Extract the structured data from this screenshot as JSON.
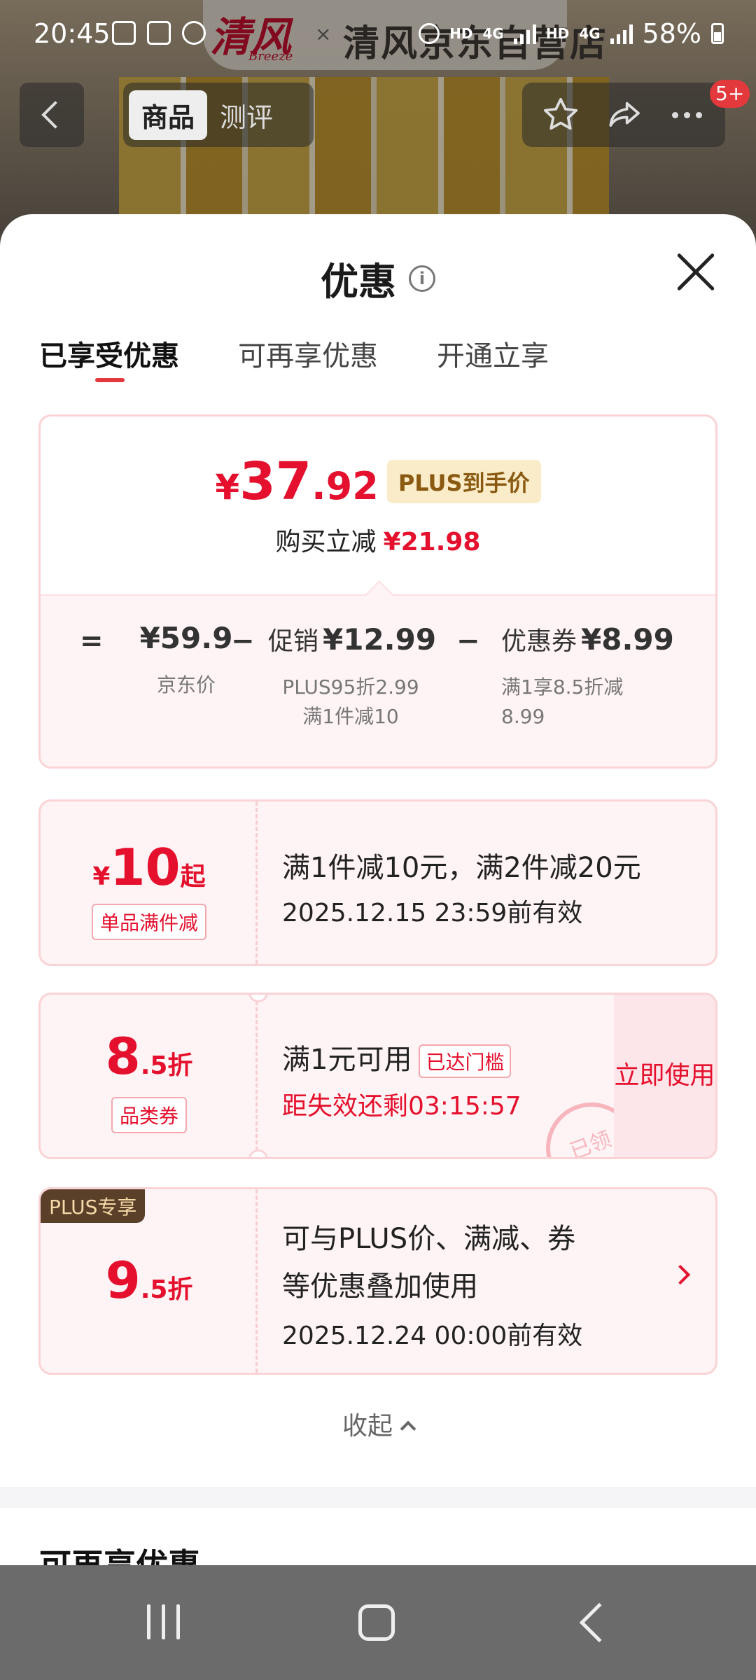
{
  "status_bar": {
    "time": "20:45",
    "battery": "58%",
    "net1": "HD",
    "net2": "4G",
    "net3": "HD",
    "net4": "4G"
  },
  "background": {
    "brand": "清风",
    "brand_sub": "Breeze",
    "store": "清风京东自营店"
  },
  "top_nav": {
    "tabs": [
      "商品",
      "测评"
    ],
    "badge": "5+"
  },
  "sheet": {
    "title": "优惠",
    "tabs": [
      "已享受优惠",
      "可再享优惠",
      "开通立享"
    ]
  },
  "price_summary": {
    "yen": "¥",
    "price_int": "37",
    "price_dec": ".92",
    "tag": "PLUS到手价",
    "sub_label": "购买立减",
    "sub_value": "¥21.98",
    "eq": "=",
    "minus": "−",
    "jd_price": "¥59.9",
    "jd_label": "京东价",
    "promo_label": "促销",
    "promo_value": "¥12.99",
    "promo_desc1": "PLUS95折2.99",
    "promo_desc2": "满1件减10",
    "coupon_label": "优惠券",
    "coupon_value": "¥8.99",
    "coupon_desc1": "满1享8.5折减",
    "coupon_desc2": "8.99"
  },
  "coupons": [
    {
      "yen": "¥",
      "big": "10",
      "suffix": "起",
      "tag": "单品满件减",
      "line1": "满1件减10元，满2件减20元",
      "line2": "2025.12.15 23:59前有效"
    },
    {
      "big": "8",
      "suffix": ".5折",
      "tag": "品类券",
      "line1": "满1元可用",
      "inline_tag": "已达门槛",
      "line2": "距失效还剩03:15:57",
      "button": "立即使用",
      "stamp": "已领"
    },
    {
      "badge": "PLUS专享",
      "big": "9",
      "suffix": ".5折",
      "line1": "可与PLUS价、满减、券",
      "line2": "等优惠叠加使用",
      "line3": "2025.12.24 00:00前有效"
    }
  ],
  "collapse_label": "收起",
  "next_section_title": "可再享优惠"
}
